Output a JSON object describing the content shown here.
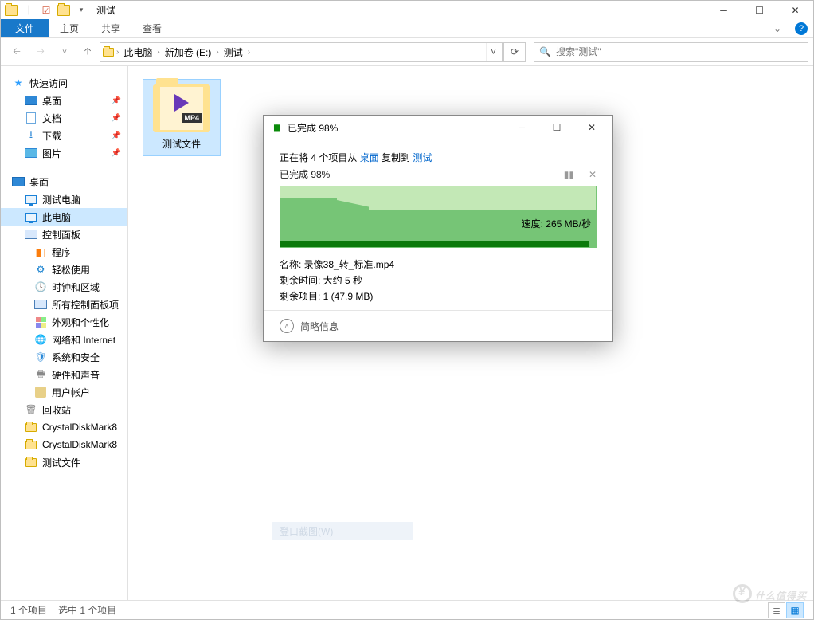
{
  "window": {
    "title": "测试"
  },
  "ribbon": {
    "file": "文件",
    "tabs": [
      "主页",
      "共享",
      "查看"
    ]
  },
  "breadcrumb": {
    "items": [
      "此电脑",
      "新加卷 (E:)",
      "测试"
    ]
  },
  "search": {
    "placeholder": "搜索\"测试\""
  },
  "tree": {
    "quick": "快速访问",
    "quick_items": [
      {
        "label": "桌面",
        "icon": "desktop"
      },
      {
        "label": "文档",
        "icon": "document"
      },
      {
        "label": "下载",
        "icon": "download"
      },
      {
        "label": "图片",
        "icon": "image"
      }
    ],
    "desktop": "桌面",
    "desktop_items": [
      {
        "label": "测试电脑",
        "icon": "pc"
      },
      {
        "label": "此电脑",
        "icon": "pc",
        "selected": true
      },
      {
        "label": "控制面板",
        "icon": "cp"
      }
    ],
    "cp_items": [
      {
        "label": "程序",
        "icon": "prog"
      },
      {
        "label": "轻松使用",
        "icon": "ease"
      },
      {
        "label": "时钟和区域",
        "icon": "clock"
      },
      {
        "label": "所有控制面板项",
        "icon": "all"
      },
      {
        "label": "外观和个性化",
        "icon": "pers"
      },
      {
        "label": "网络和 Internet",
        "icon": "net"
      },
      {
        "label": "系统和安全",
        "icon": "sec"
      },
      {
        "label": "硬件和声音",
        "icon": "snd"
      },
      {
        "label": "用户帐户",
        "icon": "usr"
      }
    ],
    "extra": [
      {
        "label": "回收站",
        "icon": "recycle"
      },
      {
        "label": "CrystalDiskMark8",
        "icon": "folder"
      },
      {
        "label": "CrystalDiskMark8",
        "icon": "folder"
      },
      {
        "label": "测试文件",
        "icon": "folder"
      }
    ]
  },
  "content": {
    "file": {
      "name": "测试文件",
      "badge": "MP4"
    }
  },
  "status": {
    "count": "1 个项目",
    "selected": "选中 1 个项目"
  },
  "dialog": {
    "title": "已完成 98%",
    "line1_pre": "正在将 4 个项目从 ",
    "line1_src": "桌面",
    "line1_mid": " 复制到 ",
    "line1_dst": "测试",
    "progress": "已完成 98%",
    "speed_label": "速度: ",
    "speed_value": "265 MB/秒",
    "name_label": "名称: ",
    "name_value": "录像38_转_标准.mp4",
    "time_label": "剩余时间: ",
    "time_value": "大约 5 秒",
    "remain_label": "剩余项目: ",
    "remain_value": "1 (47.9 MB)",
    "details": "简略信息"
  },
  "ghost_button": "登口截图(W)",
  "watermark": "什么值得买",
  "chart_data": {
    "type": "area",
    "title": "File copy transfer speed",
    "ylabel": "MB/秒",
    "ylim": [
      0,
      420
    ],
    "x_percent_complete": [
      0,
      10,
      18,
      26,
      30,
      50,
      70,
      90,
      98
    ],
    "values_mb_s": [
      310,
      310,
      305,
      270,
      260,
      262,
      265,
      265,
      265
    ],
    "current_speed": 265,
    "progress_pct": 98
  }
}
